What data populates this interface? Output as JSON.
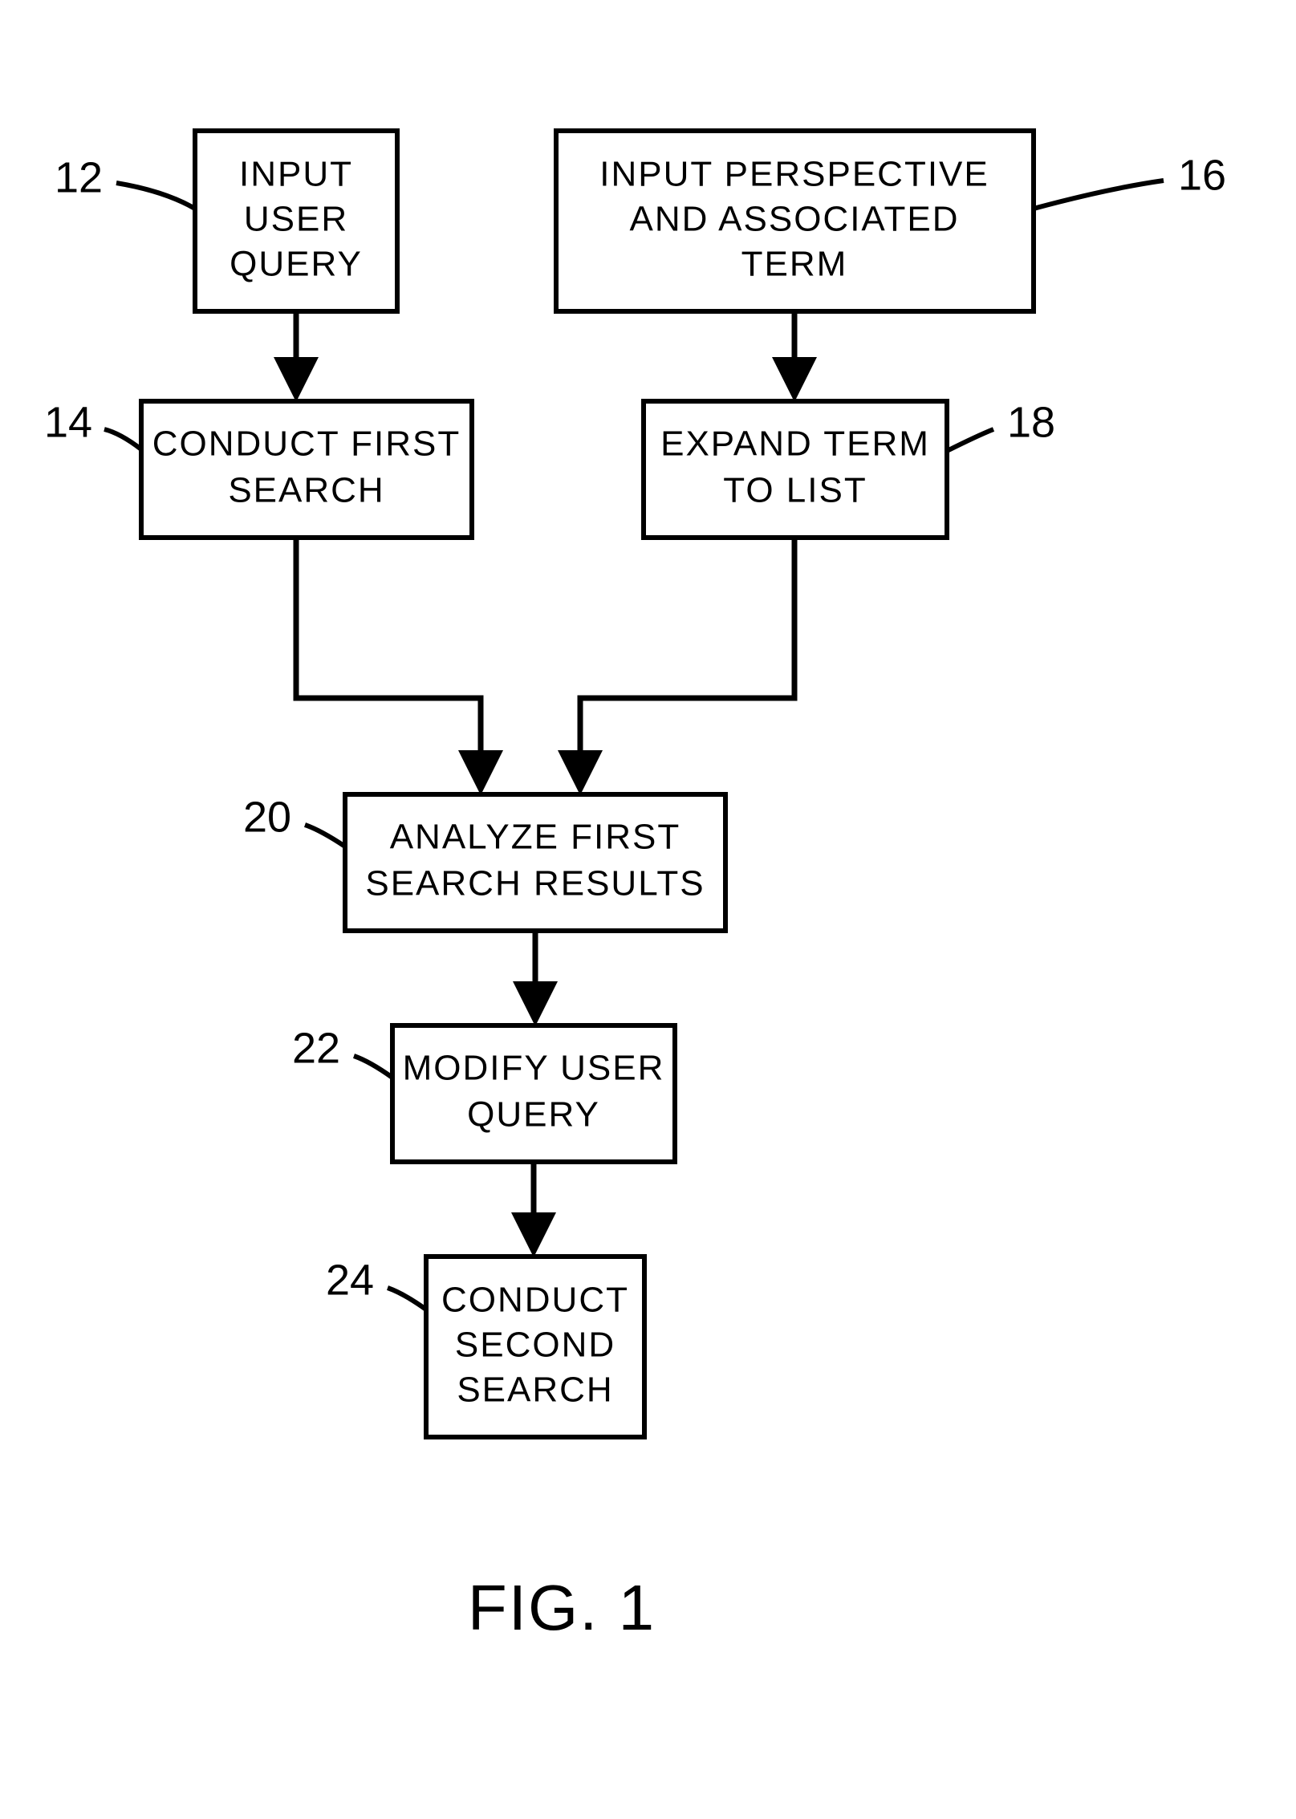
{
  "figure_caption": "FIG. 1",
  "boxes": {
    "b12": {
      "ref": "12",
      "lines": [
        "INPUT",
        "USER",
        "QUERY"
      ]
    },
    "b14": {
      "ref": "14",
      "lines": [
        "CONDUCT FIRST",
        "SEARCH"
      ]
    },
    "b16": {
      "ref": "16",
      "lines": [
        "INPUT  PERSPECTIVE",
        "AND  ASSOCIATED",
        "TERM"
      ]
    },
    "b18": {
      "ref": "18",
      "lines": [
        "EXPAND  TERM",
        "TO  LIST"
      ]
    },
    "b20": {
      "ref": "20",
      "lines": [
        "ANALYZE  FIRST",
        "SEARCH  RESULTS"
      ]
    },
    "b22": {
      "ref": "22",
      "lines": [
        "MODIFY  USER",
        "QUERY"
      ]
    },
    "b24": {
      "ref": "24",
      "lines": [
        "CONDUCT",
        "SECOND",
        "SEARCH"
      ]
    }
  },
  "chart_data": {
    "type": "flowchart",
    "nodes": [
      {
        "id": "12",
        "label": "INPUT USER QUERY"
      },
      {
        "id": "14",
        "label": "CONDUCT FIRST SEARCH"
      },
      {
        "id": "16",
        "label": "INPUT PERSPECTIVE AND ASSOCIATED TERM"
      },
      {
        "id": "18",
        "label": "EXPAND TERM TO LIST"
      },
      {
        "id": "20",
        "label": "ANALYZE FIRST SEARCH RESULTS"
      },
      {
        "id": "22",
        "label": "MODIFY USER QUERY"
      },
      {
        "id": "24",
        "label": "CONDUCT SECOND SEARCH"
      }
    ],
    "edges": [
      {
        "from": "12",
        "to": "14"
      },
      {
        "from": "16",
        "to": "18"
      },
      {
        "from": "14",
        "to": "20"
      },
      {
        "from": "18",
        "to": "20"
      },
      {
        "from": "20",
        "to": "22"
      },
      {
        "from": "22",
        "to": "24"
      }
    ]
  }
}
